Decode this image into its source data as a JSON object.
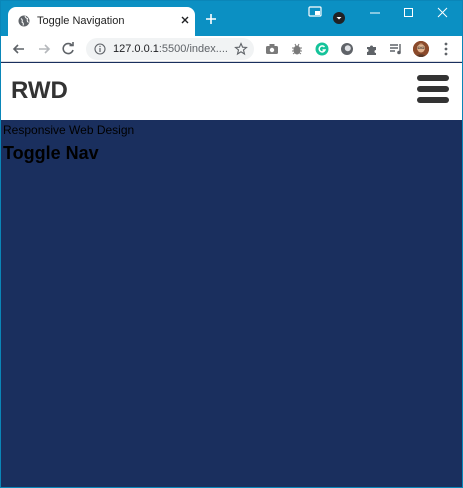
{
  "browser": {
    "tab": {
      "title": "Toggle Navigation"
    },
    "address_bar": {
      "host": "127.0.0.1",
      "path": ":5500/index...."
    }
  },
  "page": {
    "brand": "RWD",
    "subtitle": "Responsive Web Design",
    "heading": "Toggle Nav"
  },
  "colors": {
    "titlebar": "#0b90c3",
    "page_background": "#1a2f5e",
    "header_background": "#ffffff",
    "brand_text": "#333333"
  },
  "icons": [
    "globe-icon",
    "close-icon",
    "plus-icon",
    "cast-icon",
    "profile-dropdown-icon",
    "minimize-icon",
    "maximize-icon",
    "window-close-icon",
    "back-icon",
    "forward-icon",
    "reload-icon",
    "info-icon",
    "star-icon",
    "camera-icon",
    "bug-icon",
    "grammarly-icon",
    "extension-circle-icon",
    "puzzle-icon",
    "playlist-icon",
    "avatar",
    "more-vert-icon",
    "hamburger-menu-icon"
  ]
}
